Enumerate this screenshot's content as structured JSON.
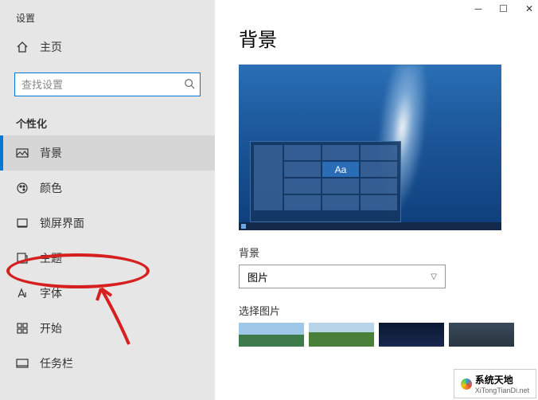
{
  "app_title": "设置",
  "home_label": "主页",
  "search": {
    "placeholder": "查找设置"
  },
  "section_label": "个性化",
  "nav": {
    "background": "背景",
    "colors": "颜色",
    "lockscreen": "锁屏界面",
    "themes": "主题",
    "fonts": "字体",
    "start": "开始",
    "taskbar": "任务栏"
  },
  "main": {
    "heading": "背景",
    "preview_sample_text": "Aa",
    "bg_label": "背景",
    "bg_dropdown_value": "图片",
    "choose_label": "选择图片"
  },
  "watermark": {
    "name": "系统天地",
    "url": "XiTongTianDi.net"
  }
}
